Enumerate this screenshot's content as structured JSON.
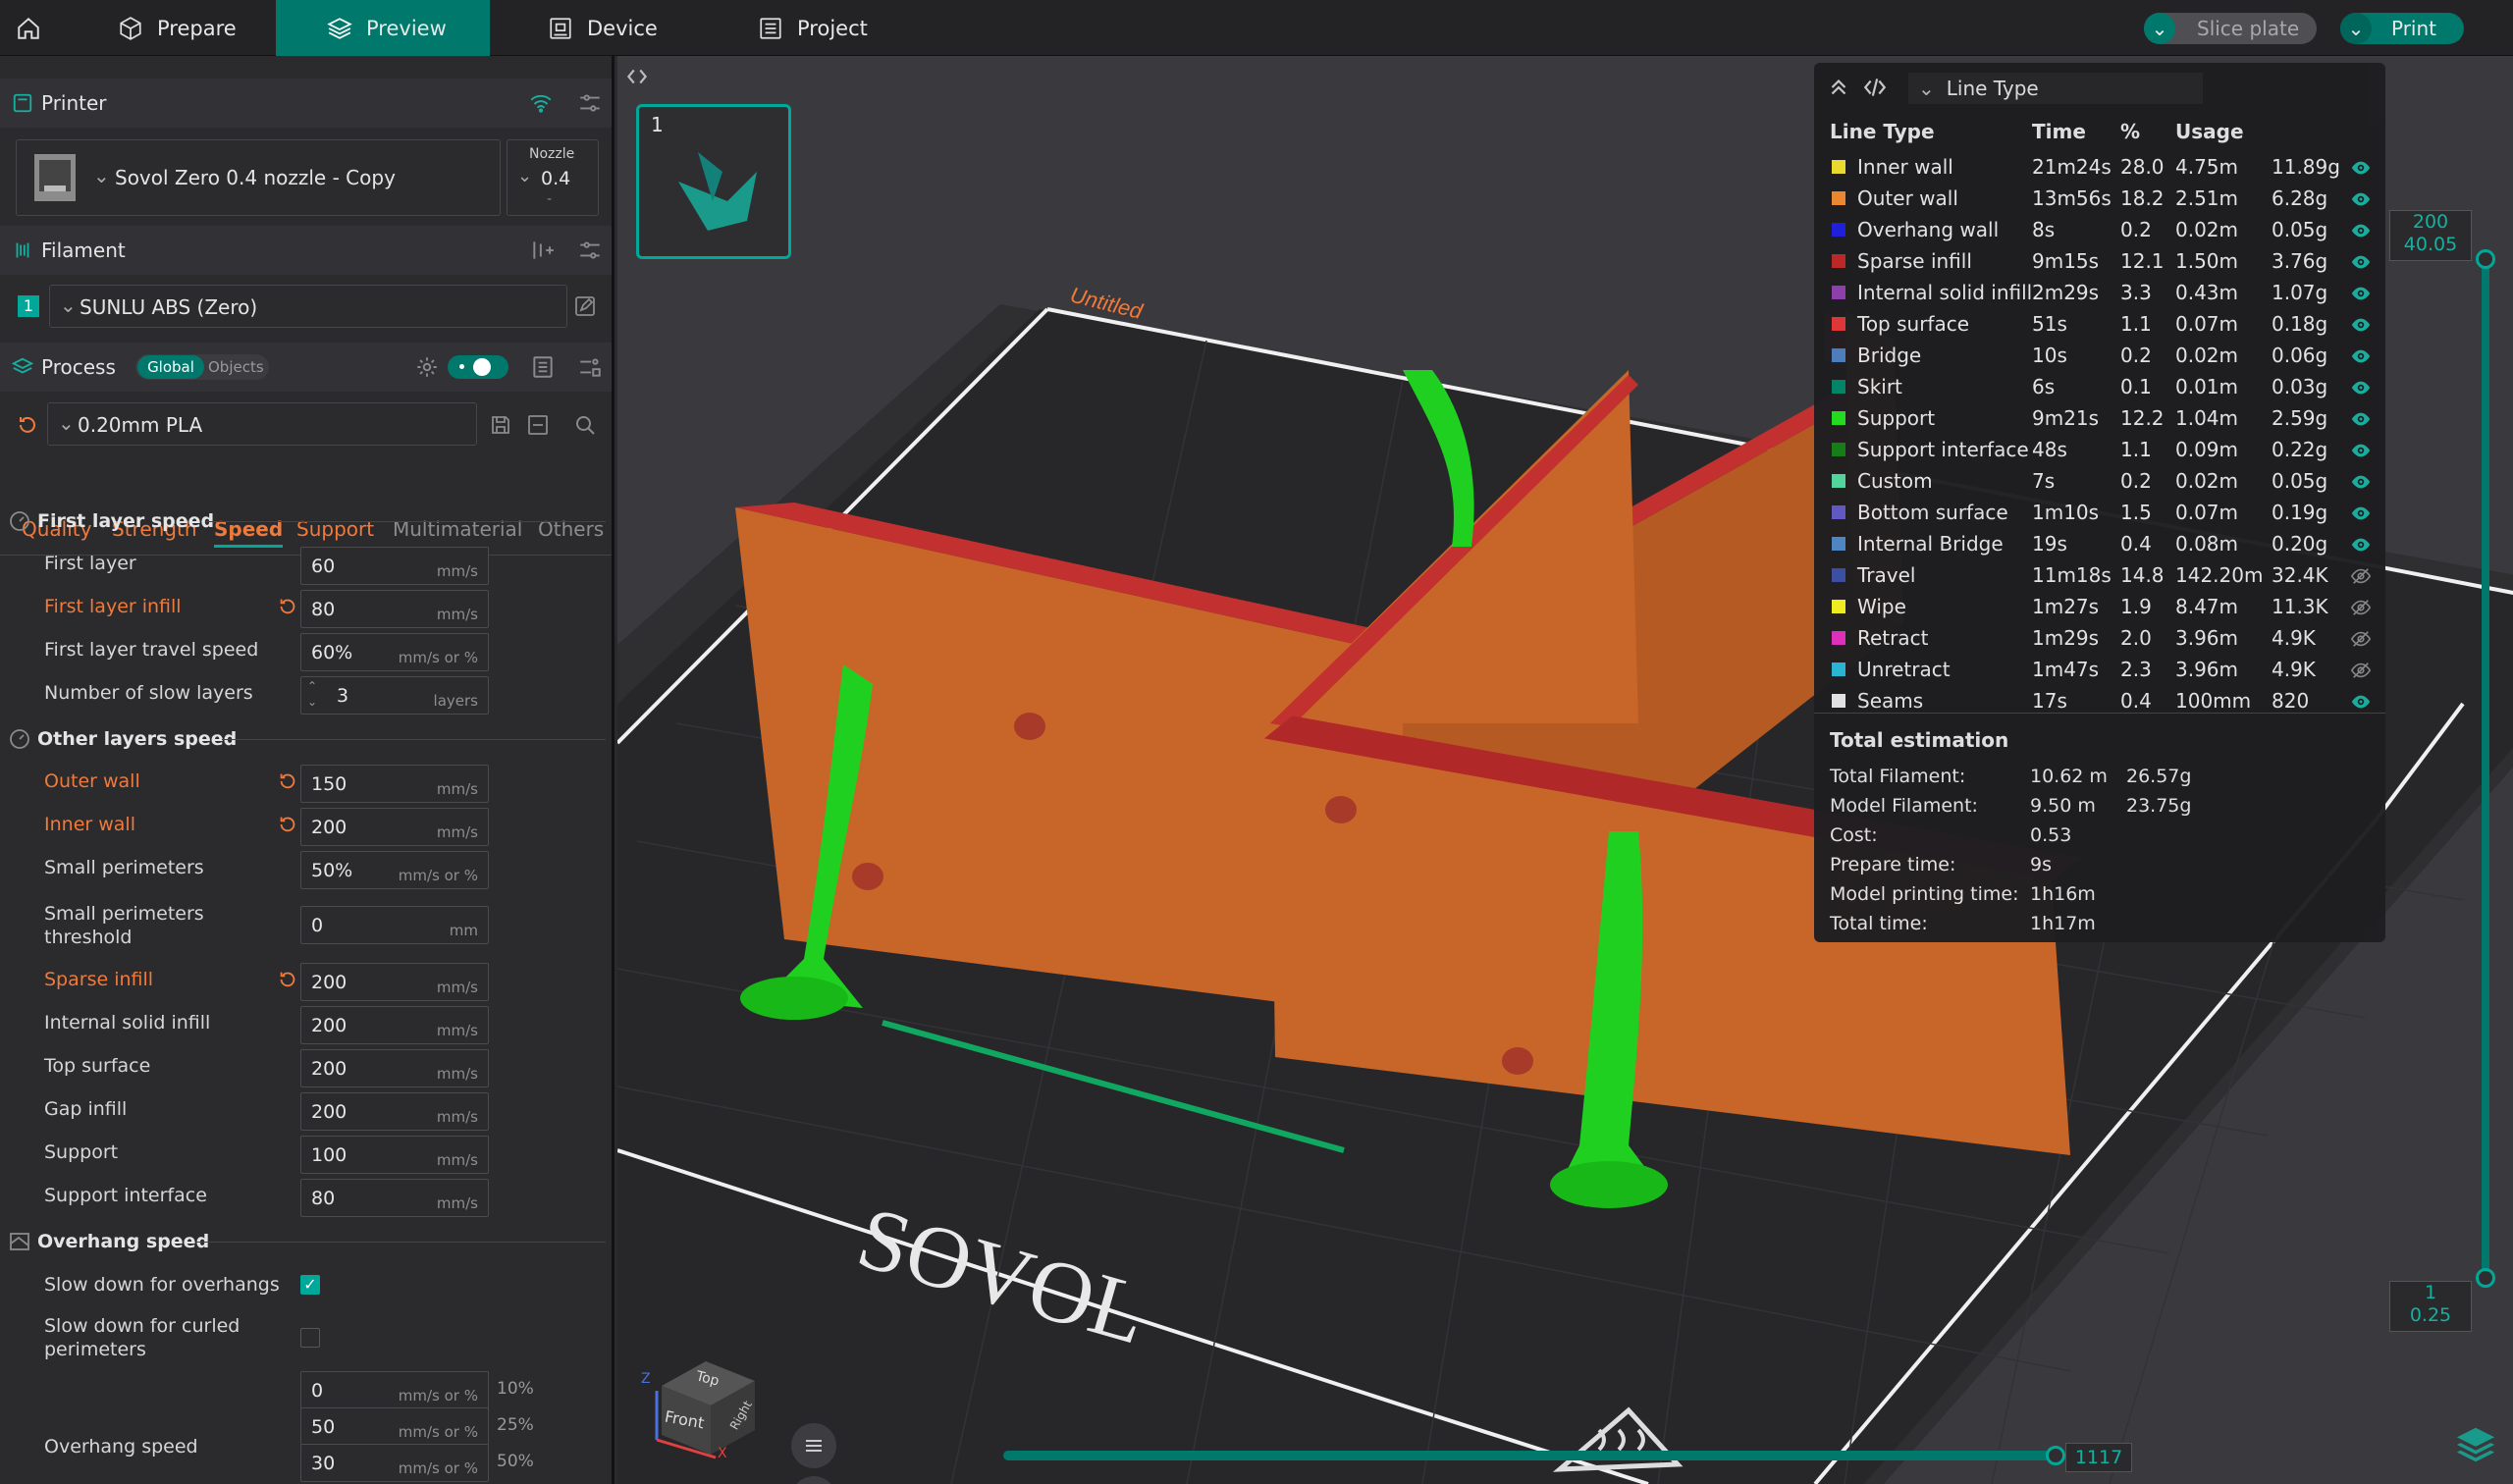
{
  "topbar": {
    "tabs": [
      {
        "label": "Prepare",
        "icon": "cube-icon"
      },
      {
        "label": "Preview",
        "icon": "layers-icon"
      },
      {
        "label": "Device",
        "icon": "device-icon"
      },
      {
        "label": "Project",
        "icon": "project-icon"
      }
    ],
    "slice_label": "Slice plate",
    "print_label": "Print"
  },
  "printer": {
    "section_label": "Printer",
    "name": "Sovol Zero 0.4 nozzle - Copy",
    "nozzle_label": "Nozzle",
    "nozzle_value": "0.4",
    "nozzle_dash": "-"
  },
  "filament": {
    "section_label": "Filament",
    "slot": "1",
    "name": "SUNLU ABS (Zero)"
  },
  "process": {
    "section_label": "Process",
    "global_label": "Global",
    "objects_label": "Objects",
    "preset": "0.20mm PLA",
    "tabs": [
      "Quality",
      "Strength",
      "Speed",
      "Support",
      "Multimaterial",
      "Others"
    ]
  },
  "first_layer_speed": {
    "title": "First layer speed",
    "rows": [
      {
        "label": "First layer",
        "value": "60",
        "unit": "mm/s"
      },
      {
        "label": "First layer infill",
        "value": "80",
        "unit": "mm/s"
      },
      {
        "label": "First layer travel speed",
        "value": "60%",
        "unit": "mm/s or %"
      },
      {
        "label": "Number of slow layers",
        "value": "3",
        "unit": "layers"
      }
    ]
  },
  "other_layers_speed": {
    "title": "Other layers speed",
    "rows": [
      {
        "label": "Outer wall",
        "value": "150",
        "unit": "mm/s"
      },
      {
        "label": "Inner wall",
        "value": "200",
        "unit": "mm/s"
      },
      {
        "label": "Small perimeters",
        "value": "50%",
        "unit": "mm/s or %"
      },
      {
        "label": "Small perimeters",
        "label2": "threshold",
        "value": "0",
        "unit": "mm"
      },
      {
        "label": "Sparse infill",
        "value": "200",
        "unit": "mm/s"
      },
      {
        "label": "Internal solid infill",
        "value": "200",
        "unit": "mm/s"
      },
      {
        "label": "Top surface",
        "value": "200",
        "unit": "mm/s"
      },
      {
        "label": "Gap infill",
        "value": "200",
        "unit": "mm/s"
      },
      {
        "label": "Support",
        "value": "100",
        "unit": "mm/s"
      },
      {
        "label": "Support interface",
        "value": "80",
        "unit": "mm/s"
      }
    ]
  },
  "overhang_speed": {
    "title": "Overhang speed",
    "slow_down_label": "Slow down for overhangs",
    "curled_label": "Slow down for curled",
    "curled_label2": "perimeters",
    "overhang_label": "Overhang speed",
    "rows": [
      {
        "value": "0",
        "unit": "mm/s or %",
        "pct": "10%"
      },
      {
        "value": "50",
        "unit": "mm/s or %",
        "pct": "25%"
      },
      {
        "value": "30",
        "unit": "mm/s or %",
        "pct": "50%"
      }
    ]
  },
  "viewport": {
    "plate_number": "1",
    "plate_name": "Untitled",
    "bed_brand": "SOVOL",
    "cube_top": "Top",
    "cube_front": "Front",
    "cube_right": "Right",
    "axis_z": "Z",
    "axis_x": "X",
    "layer_top": "200",
    "layer_top_height": "40.05",
    "layer_bottom": "1",
    "layer_bottom_height": "0.25",
    "move_count": "1117"
  },
  "line_type": {
    "selector_label": "Line Type",
    "headers": [
      "Line Type",
      "Time",
      "%",
      "Usage"
    ],
    "rows": [
      {
        "name": "Inner wall",
        "color": "#f0e030",
        "time": "21m24s",
        "pct": "28.0",
        "len": "4.75m",
        "weight": "11.89g",
        "visible": true
      },
      {
        "name": "Outer wall",
        "color": "#f08a30",
        "time": "13m56s",
        "pct": "18.2",
        "len": "2.51m",
        "weight": "6.28g",
        "visible": true
      },
      {
        "name": "Overhang wall",
        "color": "#2020e0",
        "time": "8s",
        "pct": "0.2",
        "len": "0.02m",
        "weight": "0.05g",
        "visible": true
      },
      {
        "name": "Sparse infill",
        "color": "#c02828",
        "time": "9m15s",
        "pct": "12.1",
        "len": "1.50m",
        "weight": "3.76g",
        "visible": true
      },
      {
        "name": "Internal solid infill",
        "color": "#9040b0",
        "time": "2m29s",
        "pct": "3.3",
        "len": "0.43m",
        "weight": "1.07g",
        "visible": true
      },
      {
        "name": "Top surface",
        "color": "#e03838",
        "time": "51s",
        "pct": "1.1",
        "len": "0.07m",
        "weight": "0.18g",
        "visible": true
      },
      {
        "name": "Bridge",
        "color": "#4a80c0",
        "time": "10s",
        "pct": "0.2",
        "len": "0.02m",
        "weight": "0.06g",
        "visible": true
      },
      {
        "name": "Skirt",
        "color": "#008868",
        "time": "6s",
        "pct": "0.1",
        "len": "0.01m",
        "weight": "0.03g",
        "visible": true
      },
      {
        "name": "Support",
        "color": "#20e020",
        "time": "9m21s",
        "pct": "12.2",
        "len": "1.04m",
        "weight": "2.59g",
        "visible": true
      },
      {
        "name": "Support interface",
        "color": "#108018",
        "time": "48s",
        "pct": "1.1",
        "len": "0.09m",
        "weight": "0.22g",
        "visible": true
      },
      {
        "name": "Custom",
        "color": "#50d8a0",
        "time": "7s",
        "pct": "0.2",
        "len": "0.02m",
        "weight": "0.05g",
        "visible": true
      },
      {
        "name": "Bottom surface",
        "color": "#6058c8",
        "time": "1m10s",
        "pct": "1.5",
        "len": "0.07m",
        "weight": "0.19g",
        "visible": true
      },
      {
        "name": "Internal Bridge",
        "color": "#4a88c8",
        "time": "19s",
        "pct": "0.4",
        "len": "0.08m",
        "weight": "0.20g",
        "visible": true
      },
      {
        "name": "Travel",
        "color": "#3850a8",
        "time": "11m18s",
        "pct": "14.8",
        "len": "142.20m",
        "weight": "32.4K",
        "visible": false
      },
      {
        "name": "Wipe",
        "color": "#f0f020",
        "time": "1m27s",
        "pct": "1.9",
        "len": "8.47m",
        "weight": "11.3K",
        "visible": false
      },
      {
        "name": "Retract",
        "color": "#e030c0",
        "time": "1m29s",
        "pct": "2.0",
        "len": "3.96m",
        "weight": "4.9K",
        "visible": false
      },
      {
        "name": "Unretract",
        "color": "#28b8d8",
        "time": "1m47s",
        "pct": "2.3",
        "len": "3.96m",
        "weight": "4.9K",
        "visible": false
      },
      {
        "name": "Seams",
        "color": "#e8e8e8",
        "time": "17s",
        "pct": "0.4",
        "len": "100mm",
        "weight": "820",
        "visible": true
      }
    ]
  },
  "estimation": {
    "title": "Total estimation",
    "rows": [
      {
        "label": "Total Filament:",
        "v1": "10.62 m",
        "v2": "26.57g"
      },
      {
        "label": "Model Filament:",
        "v1": "9.50 m",
        "v2": "23.75g"
      },
      {
        "label": "Cost:",
        "v1": "0.53",
        "v2": ""
      },
      {
        "label": "Prepare time:",
        "v1": "9s",
        "v2": ""
      },
      {
        "label": "Model printing time:",
        "v1": "1h16m",
        "v2": ""
      },
      {
        "label": "Total time:",
        "v1": "1h17m",
        "v2": ""
      }
    ]
  }
}
